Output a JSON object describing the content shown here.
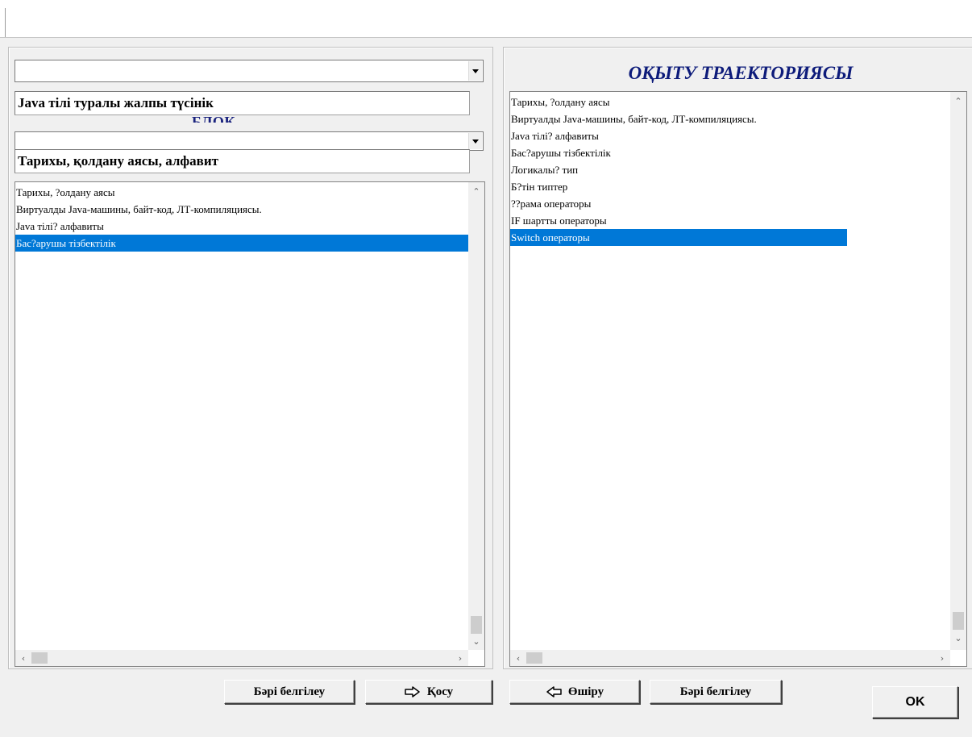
{
  "left": {
    "module_combo_value": "",
    "module_text": "Java тілі туралы жалпы түсінік",
    "block_label": "БЛОК",
    "block_combo_value": "",
    "block_text": "Тарихы, қолдану аясы, алфавит",
    "items": [
      "Тарихы, ?олдану аясы",
      "Виртуалды Java-машины, байт-код, ЛТ-компиляциясы.",
      "Java тілі? алфавиты",
      "Бас?арушы тізбектілік"
    ]
  },
  "right": {
    "title": "ОҚЫТУ ТРАЕКТОРИЯСЫ",
    "items": [
      "Тарихы, ?олдану аясы",
      "Виртуалды Java-машины, байт-код, ЛТ-компиляциясы.",
      "Java тілі? алфавиты",
      "Бас?арушы тізбектілік",
      "Логикалы? тип",
      "Б?тін типтер",
      "??рама операторы",
      "IF шартты операторы",
      "Switch операторы"
    ]
  },
  "buttons": {
    "select_all_left": "Бәрі белгілеу",
    "add": "Қосу",
    "remove": "Өшіру",
    "select_all_right": "Бәрі белгілеу",
    "ok": "OK"
  },
  "selection": {
    "left_selected_index": 3,
    "right_selected_index": 8
  },
  "colors": {
    "selection": "#0078d7",
    "title": "#0d1b7a",
    "block_label": "#1a237e"
  }
}
